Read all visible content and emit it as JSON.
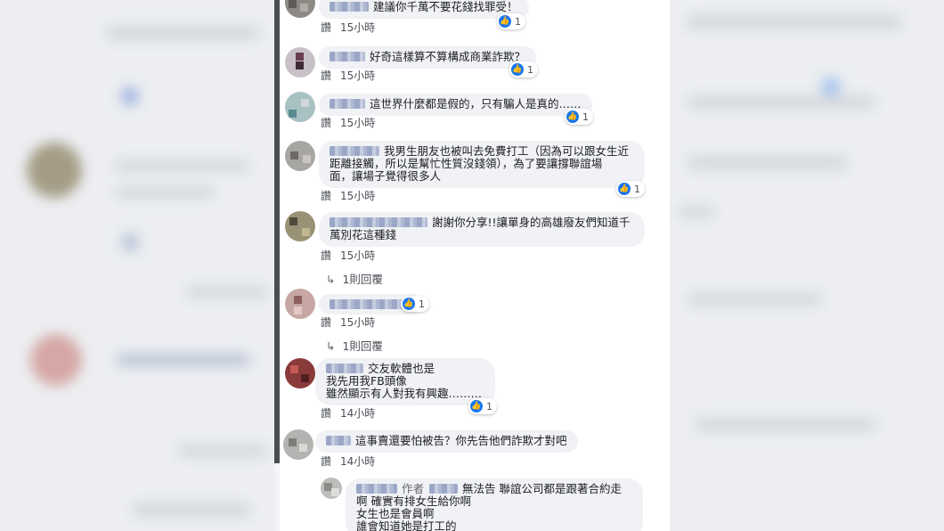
{
  "comments": [
    {
      "text": "建議你千萬不要花錢找罪受！",
      "like_label": "讚",
      "time": "15小時",
      "reactions": "1"
    },
    {
      "text": "好奇這樣算不算構成商業詐欺？",
      "like_label": "讚",
      "time": "15小時",
      "reactions": "1"
    },
    {
      "text": "這世界什麼都是假的，只有騙人是真的……",
      "like_label": "讚",
      "time": "15小時",
      "reactions": "1"
    },
    {
      "text_lines": [
        "我男生朋友也被叫去免費打工（因為可以跟女生近",
        "距離接觸，所以是幫忙性質沒錢領），為了要讓撐聯誼場",
        "面，讓場子覺得很多人"
      ],
      "like_label": "讚",
      "time": "15小時",
      "reactions": "1"
    },
    {
      "text_lines": [
        "謝謝你分享!!讓單身的高雄廢友們知道千",
        "萬別花這種錢"
      ],
      "like_label": "讚",
      "time": "15小時",
      "replies": "1則回覆"
    },
    {
      "text": "",
      "like_label": "讚",
      "time": "15小時",
      "reactions": "1",
      "replies": "1則回覆"
    },
    {
      "text_lines": [
        "交友軟體也是",
        "我先用我FB頭像",
        "雖然顯示有人對我有興趣………"
      ],
      "like_label": "讚",
      "time": "14小時",
      "reactions": "1"
    },
    {
      "text": "這事賣還要怕被告？你先告他們詐欺才對吧",
      "like_label": "讚",
      "time": "14小時"
    },
    {
      "author_badge": "作者",
      "text_lines": [
        "無法告 聯誼公司都是跟著合約走",
        "啊 確實有排女生給你啊",
        "女生也是會員啊",
        "誰會知道她是打工的"
      ]
    }
  ]
}
